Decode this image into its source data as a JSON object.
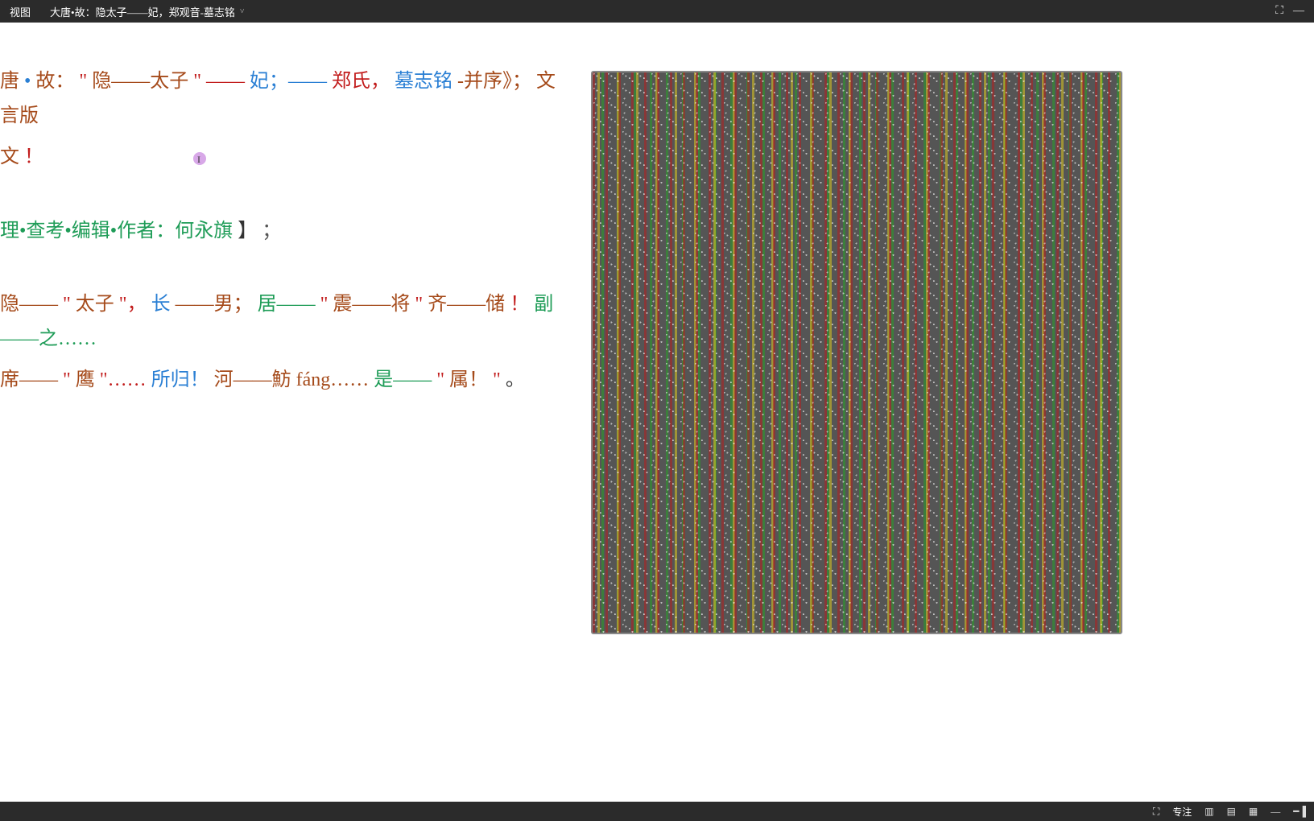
{
  "titlebar": {
    "menu_view": "视图",
    "doc_title": "大唐•故：隐太子——妃，郑观音-墓志铭",
    "chevron": "˅",
    "icon_fit": "⛶",
    "icon_min": "—"
  },
  "doc": {
    "line1": {
      "t1": "唐",
      "dot1": "•",
      "t2": "故：",
      "q1": "\"",
      "t3": "隐——太子",
      "q2": "\" ——",
      "t4": "妃；——",
      "t5": "郑氏，",
      "t6": "墓志铭",
      "t7": "-并序》；",
      "t8": "文言版"
    },
    "line2": {
      "t1": "文",
      "t2": "！"
    },
    "line3": {
      "t1": "理•查考•编辑•作者：何永旗",
      "t2": "】",
      "t3": "；"
    },
    "line4": {
      "a1": "隐——",
      "a2": "\"",
      "a3": "太子",
      "a4": "\"，",
      "a5": "长",
      "a6": "——男；",
      "a7": "居——",
      "a8": "\"",
      "a9": "震——将",
      "a10": "\"",
      "a11": "齐——储",
      "a12": "！",
      "a13": "副——之……"
    },
    "line5": {
      "b1": "席——",
      "b2": "\"",
      "b3": "鹰",
      "b4": "\"……",
      "b5": "所归！",
      "b6": " 河——魴 fáng……",
      "b7": "是——",
      "b8": "\"",
      "b9": "属！",
      "b10": "\"",
      "b11": "。"
    }
  },
  "statusbar": {
    "focus": "专注",
    "icon_focus": "⛶",
    "icon_book": "▥",
    "icon_page": "▤",
    "icon_web": "▦",
    "icon_minus": "—",
    "icon_slider": "━▐"
  }
}
